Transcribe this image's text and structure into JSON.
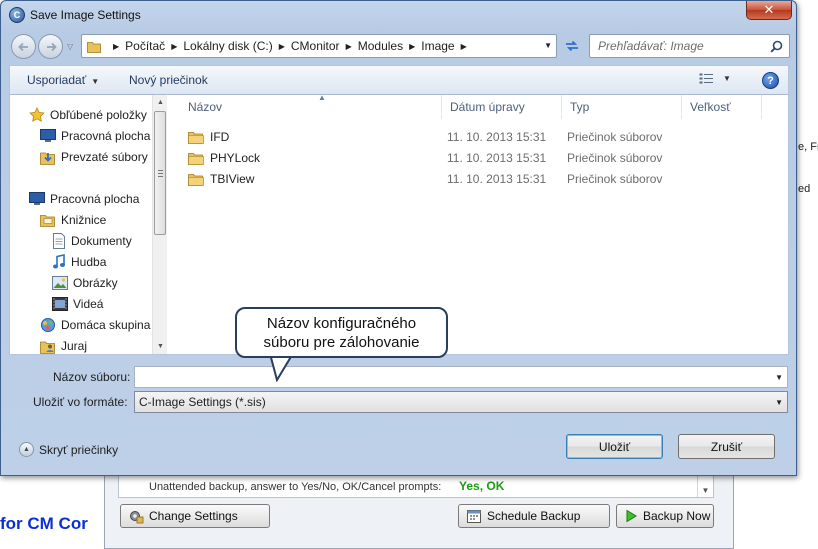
{
  "dialog": {
    "title": "Save Image Settings",
    "close_glyph": "✕",
    "address": {
      "breadcrumbs": [
        "Počítač",
        "Lokálny disk (C:)",
        "CMonitor",
        "Modules",
        "Image"
      ]
    },
    "search": {
      "placeholder": "Prehľadávať: Image"
    },
    "toolbar": {
      "organize_label": "Usporiadať",
      "new_folder_label": "Nový priečinok",
      "help_glyph": "?"
    },
    "nav_pane": {
      "items": [
        {
          "label": "Obľúbené položky",
          "icon": "star-icon"
        },
        {
          "label": "Pracovná plocha",
          "icon": "desktop-icon"
        },
        {
          "label": "Prevzaté súbory",
          "icon": "downloads-icon"
        },
        {
          "label": "Pracovná plocha",
          "icon": "desktop-icon"
        },
        {
          "label": "Knižnice",
          "icon": "libraries-icon"
        },
        {
          "label": "Dokumenty",
          "icon": "documents-icon"
        },
        {
          "label": "Hudba",
          "icon": "music-icon"
        },
        {
          "label": "Obrázky",
          "icon": "pictures-icon"
        },
        {
          "label": "Videá",
          "icon": "videos-icon"
        },
        {
          "label": "Domáca skupina",
          "icon": "homegroup-icon"
        },
        {
          "label": "Juraj",
          "icon": "user-folder-icon"
        }
      ]
    },
    "columns": {
      "name": "Názov",
      "modified": "Dátum úpravy",
      "type": "Typ",
      "size": "Veľkosť"
    },
    "files": [
      {
        "name": "IFD",
        "modified": "11. 10. 2013 15:31",
        "type": "Priečinok súborov"
      },
      {
        "name": "PHYLock",
        "modified": "11. 10. 2013 15:31",
        "type": "Priečinok súborov"
      },
      {
        "name": "TBIView",
        "modified": "11. 10. 2013 15:31",
        "type": "Priečinok súborov"
      }
    ],
    "callout": {
      "line1": "Názov konfiguračného",
      "line2": "súboru pre zálohovanie"
    },
    "form": {
      "filename_label": "Názov súboru:",
      "filename_value": "",
      "format_label": "Uložiť vo formáte:",
      "format_value": "C-Image Settings (*.sis)",
      "hide_folders_label": "Skryť priečinky",
      "save_label": "Uložiť",
      "cancel_label": "Zrušiť"
    }
  },
  "background": {
    "option_label": "Unattended backup, answer to Yes/No, OK/Cancel prompts:",
    "option_value": "Yes, OK",
    "change_settings_label": "Change Settings",
    "schedule_backup_label": "Schedule Backup",
    "backup_now_label": "Backup Now",
    "heading_fragment": "for CM Cor",
    "side_fragment_1": "e, Fr",
    "side_fragment_2": "ed"
  },
  "colors": {
    "dialog_chrome": "#bdd0e7",
    "accent_value": "#1c9b14",
    "heading_blue": "#0b2fd6"
  }
}
